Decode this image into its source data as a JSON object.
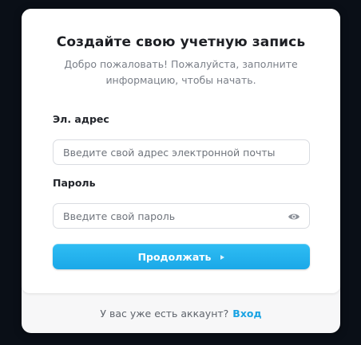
{
  "form": {
    "title": "Создайте свою учетную запись",
    "subtitle": "Добро пожаловать! Пожалуйста, заполните информацию, чтобы начать.",
    "email": {
      "label": "Эл. адрес",
      "placeholder": "Введите свой адрес электронной почты",
      "value": ""
    },
    "password": {
      "label": "Пароль",
      "placeholder": "Введите свой пароль",
      "value": "",
      "toggle_icon": "eye-icon"
    },
    "submit": {
      "label": "Продолжать",
      "icon": "caret-right-icon"
    }
  },
  "footer": {
    "text": "У вас уже есть аккаунт?",
    "link_label": "Вход"
  },
  "colors": {
    "accent": "#1ba8e8",
    "link": "#1aa3e3",
    "background": "#0a0f17"
  }
}
